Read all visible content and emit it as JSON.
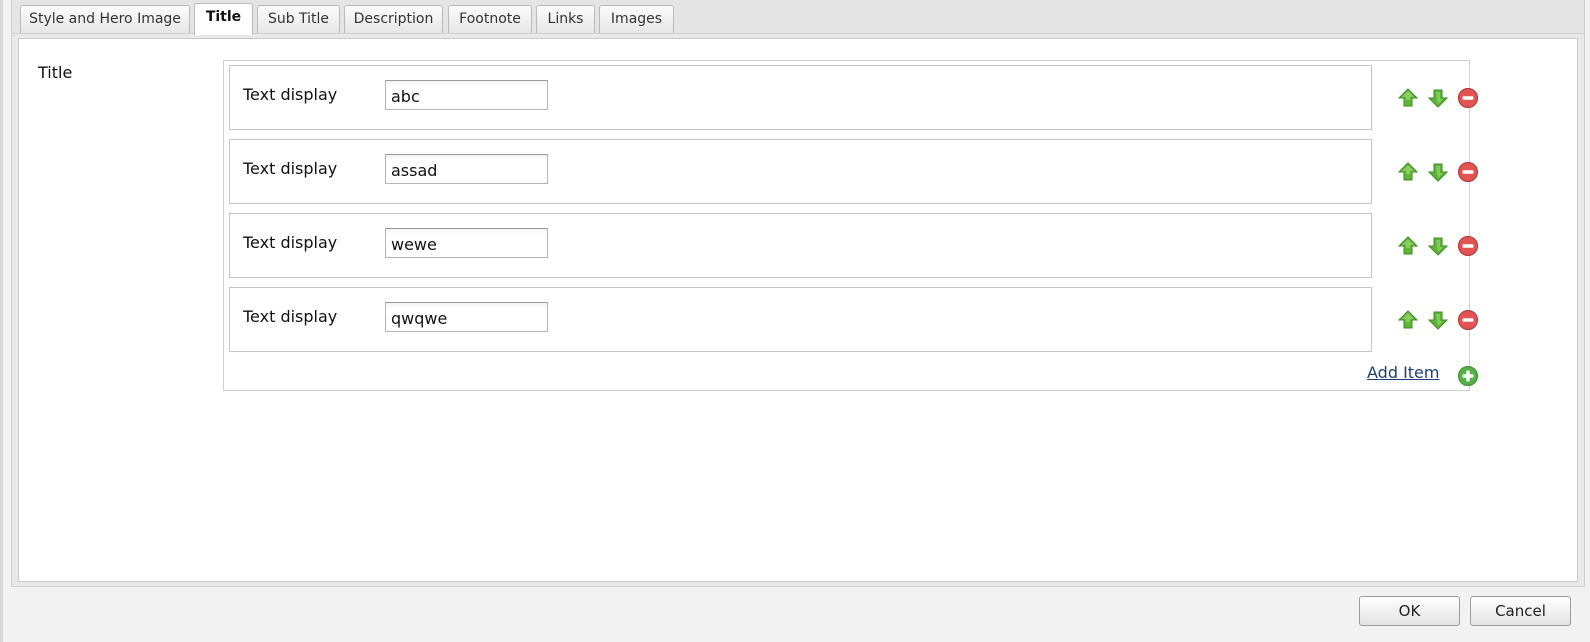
{
  "tabs": [
    {
      "label": "Style and Hero Image",
      "active": false
    },
    {
      "label": "Title",
      "active": true
    },
    {
      "label": "Sub Title",
      "active": false
    },
    {
      "label": "Description",
      "active": false
    },
    {
      "label": "Footnote",
      "active": false
    },
    {
      "label": "Links",
      "active": false
    },
    {
      "label": "Images",
      "active": false
    }
  ],
  "field": {
    "label": "Title",
    "items": [
      {
        "label": "Text display",
        "value": "abc"
      },
      {
        "label": "Text display",
        "value": "assad"
      },
      {
        "label": "Text display",
        "value": "wewe"
      },
      {
        "label": "Text display",
        "value": "qwqwe"
      }
    ],
    "add_item_label": "Add Item"
  },
  "icons": {
    "move_up": "arrow-up-icon",
    "move_down": "arrow-down-icon",
    "remove": "minus-circle-icon",
    "add": "plus-circle-icon"
  },
  "colors": {
    "arrow_green": "#5fb536",
    "remove_red": "#e25454",
    "add_green": "#56b146",
    "link": "#1f3f73"
  },
  "footer": {
    "ok_label": "OK",
    "cancel_label": "Cancel"
  }
}
